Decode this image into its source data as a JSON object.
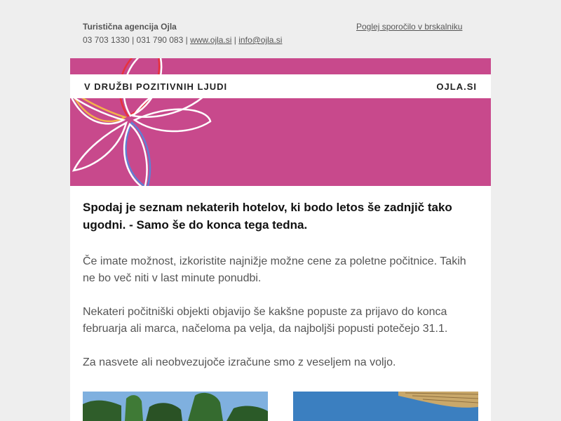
{
  "header": {
    "agency": "Turistična agencija Ojla",
    "phone1": "03 703 1330",
    "phone2": "031 790 083",
    "website": "www.ojla.si",
    "email": "info@ojla.si",
    "sep": "|",
    "view_in_browser": "Poglej sporočilo v brskalniku"
  },
  "banner": {
    "tagline": "V DRUŽBI POZITIVNIH LJUDI",
    "brand": "OJLA.SI",
    "color": "#c8498c"
  },
  "content": {
    "headline": "Spodaj je seznam nekaterih hotelov, ki bodo letos še zadnjič tako ugodni. - Samo še do konca tega tedna.",
    "para1": "Če imate možnost, izkoristite najnižje možne cene za poletne počitnice. Takih ne bo več niti v last minute ponudbi.",
    "para2": "Nekateri počitniški objekti objavijo še kakšne popuste za prijavo do konca februarja ali marca, načeloma pa velja, da najboljši popusti potečejo 31.1.",
    "para3": "Za nasvete ali neobvezujoče izračune smo z veseljem na voljo."
  }
}
